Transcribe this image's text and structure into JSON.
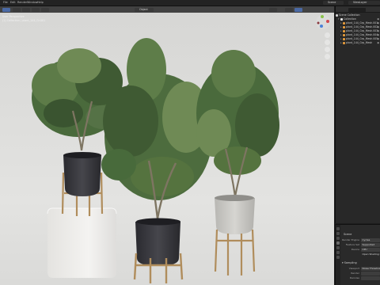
{
  "topbar": {
    "menu": [
      "File",
      "Edit",
      "Render",
      "Window",
      "Help"
    ],
    "scene_name": "Scene",
    "view_layer": "ViewLayer"
  },
  "viewport": {
    "mode": "Object",
    "overlay_line1": "User Perspective",
    "overlay_line2": "(1) Collection | plant_144_Gr.001",
    "options_label": "Options"
  },
  "outliner": {
    "root": "Scene Collection",
    "collection": "Collection",
    "items": [
      "plant_144_Grp_Mesh.001",
      "plant_144_Grp_Mesh.002",
      "plant_144_Grp_Mesh.003",
      "plant_144_Grp_Mesh.004",
      "plant_144_Grp_Mesh.005",
      "plant_144_Grp_Mesh"
    ]
  },
  "properties": {
    "title": "Scene",
    "rows": [
      {
        "label": "Render Engine",
        "value": "Cycles"
      },
      {
        "label": "Feature Set",
        "value": "Supported"
      },
      {
        "label": "Device",
        "value": "CPU"
      },
      {
        "label": "",
        "value": "Open Shading Language"
      }
    ],
    "section": "Sampling",
    "viewport_label": "Viewport",
    "viewport_value": "Noise Threshold",
    "rows2": [
      {
        "label": "Render",
        "value": ""
      },
      {
        "label": "Denoise",
        "value": ""
      }
    ]
  },
  "colors": {
    "pot_dark": "#35353a",
    "pot_light": "#c9c8c4",
    "plinth": "#ecebe8",
    "stand_brass": "#b08d5c",
    "foliage_dark": "#3f5a33",
    "foliage_light": "#6f8a55",
    "bark": "#7e7562",
    "accent_blue": "#4b6aa5"
  }
}
